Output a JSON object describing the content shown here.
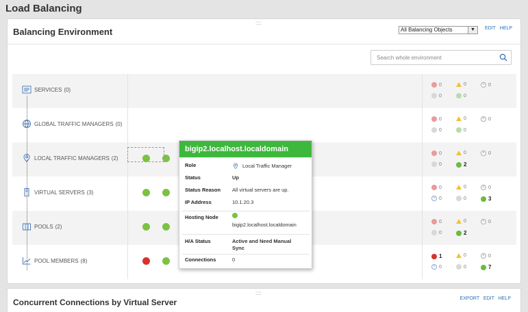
{
  "page": {
    "title": "Load Balancing"
  },
  "panel": {
    "title": "Balancing Environment",
    "grip": "::::",
    "filter_value": "All Balancing Objects",
    "links": [
      "EDIT",
      "HELP"
    ],
    "search_placeholder": "Search whole environment"
  },
  "rows": [
    {
      "label": "SERVICES",
      "count": "(0)",
      "icon": "services-icon",
      "stats": {
        "critical": "0",
        "warning": "0",
        "down": "0",
        "unknown": "0",
        "up": "0"
      }
    },
    {
      "label": "GLOBAL TRAFFIC MANAGERS",
      "count": "(0)",
      "icon": "globe-icon",
      "stats": {
        "critical": "0",
        "warning": "0",
        "down": "0",
        "unknown": "0",
        "up": "0"
      }
    },
    {
      "label": "LOCAL TRAFFIC MANAGERS",
      "count": "(2)",
      "icon": "location-pin-icon",
      "stats": {
        "critical": "0",
        "warning": "0",
        "down": "0",
        "unknown": "0",
        "up": "2"
      }
    },
    {
      "label": "VIRTUAL SERVERS",
      "count": "(3)",
      "icon": "server-icon",
      "stats": {
        "critical": "0",
        "warning": "0",
        "down": "0",
        "unreachable": "0",
        "unknown": "0",
        "up": "3"
      }
    },
    {
      "label": "POOLS",
      "count": "(2)",
      "icon": "pools-icon",
      "stats": {
        "critical": "0",
        "warning": "0",
        "down": "0",
        "unknown": "0",
        "up": "2"
      }
    },
    {
      "label": "POOL MEMBERS",
      "count": "(8)",
      "icon": "chart-icon",
      "stats": {
        "critical": "1",
        "warning": "0",
        "down": "0",
        "unreachable": "0",
        "unknown": "0",
        "up": "7"
      }
    }
  ],
  "popup": {
    "title": "bigip2.localhost.localdomain",
    "role_label": "Role",
    "role_value": "Local Traffic Manager",
    "status_label": "Status",
    "status_value": "Up",
    "reason_label": "Status Reason",
    "reason_value": "All virtual servers are up.",
    "ip_label": "IP Address",
    "ip_value": "10.1.20.3",
    "hosting_label": "Hosting Node",
    "hosting_value": "bigip2.localhost.localdomain",
    "ha_label": "H/A Status",
    "ha_value_1": "Active and Need Manual",
    "ha_value_2": "Sync",
    "conn_label": "Connections",
    "conn_value": "0"
  },
  "panel2": {
    "title": "Concurrent Connections by Virtual Server",
    "grip": "::::",
    "links": [
      "EXPORT",
      "EDIT",
      "HELP"
    ]
  },
  "colors": {
    "up": "#7bc242",
    "critical": "#d9312b",
    "popup_header": "#3db83d",
    "link": "#2a6eb5"
  }
}
